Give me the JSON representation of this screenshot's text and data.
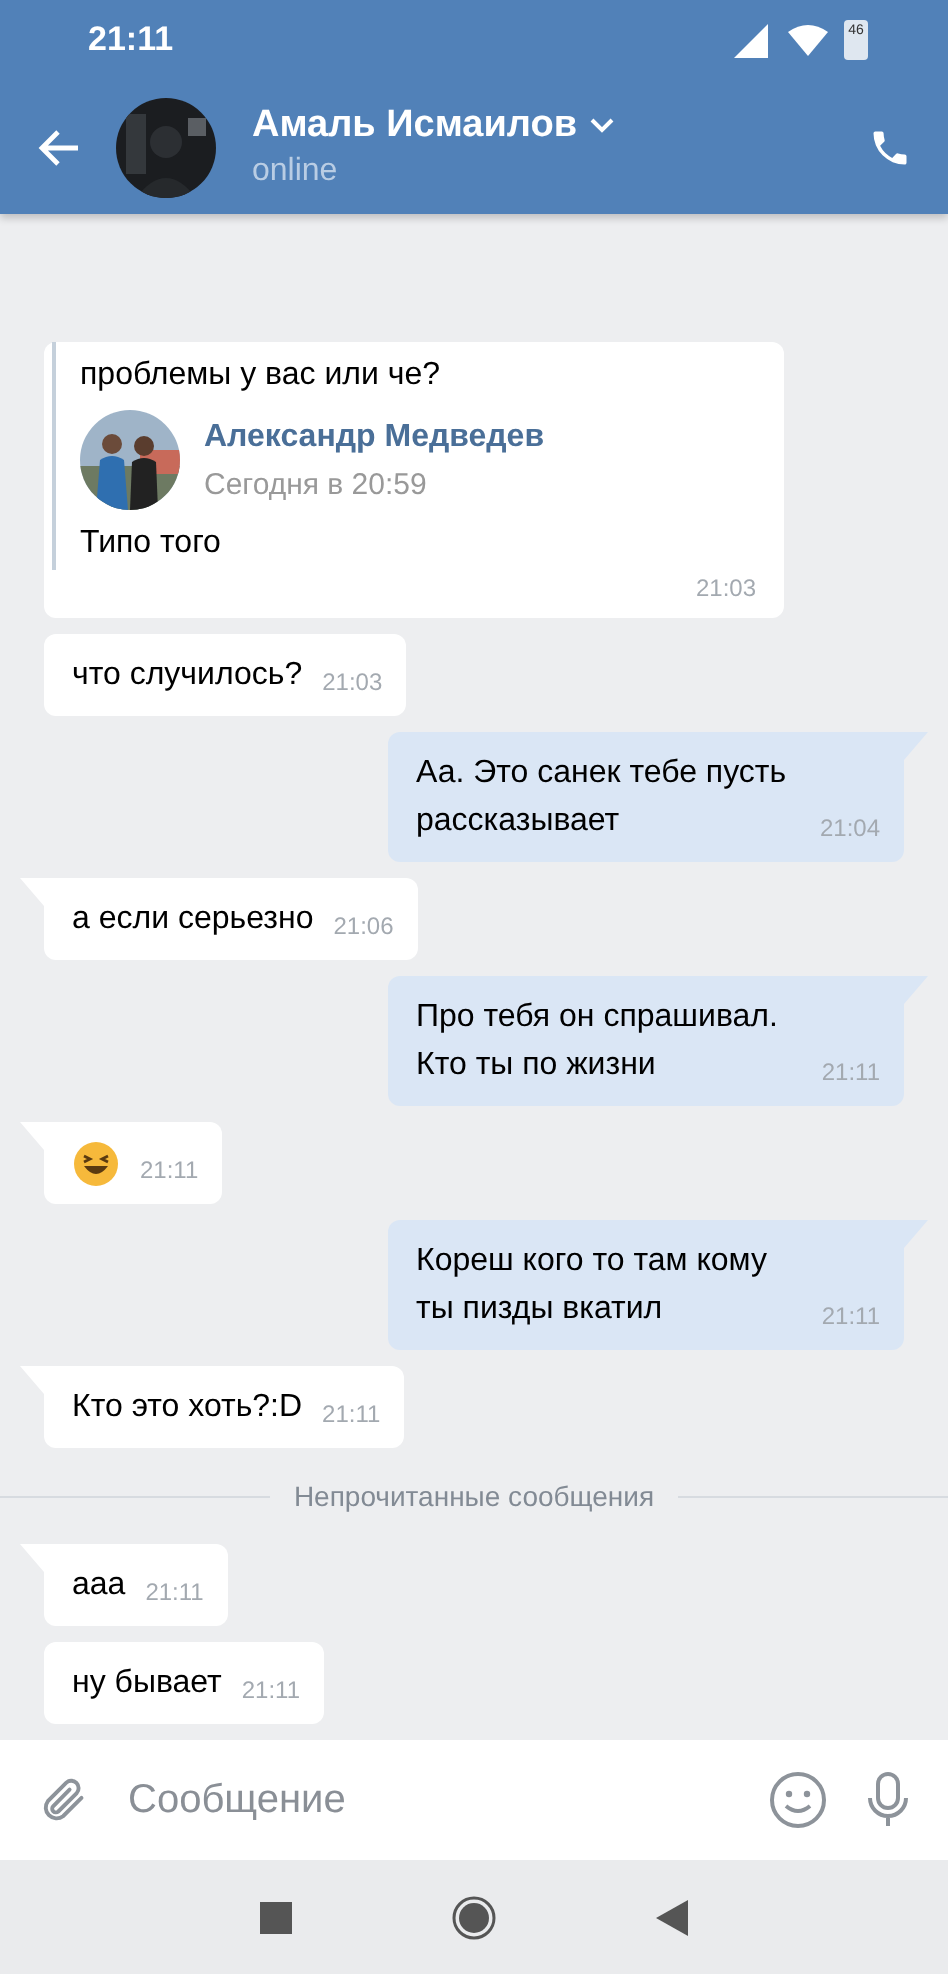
{
  "status_bar": {
    "time": "21:11",
    "battery": "46"
  },
  "header": {
    "name": "Амаль Исмаилов",
    "status": "online"
  },
  "forward": {
    "text": "проблемы у вас или че?",
    "author": "Александр Медведев",
    "date": "Сегодня в 20:59",
    "reply": "Типо того",
    "time": "21:03"
  },
  "messages": [
    {
      "kind": "in",
      "tail": false,
      "text": "что случилось?",
      "time": "21:03"
    },
    {
      "kind": "out",
      "tail": true,
      "text": "Аа. Это санек тебе пусть рассказывает",
      "time": "21:04"
    },
    {
      "kind": "in",
      "tail": true,
      "text": "а если серьезно",
      "time": "21:06"
    },
    {
      "kind": "out",
      "tail": true,
      "text": "Про тебя он спрашивал. Кто ты по жизни",
      "time": "21:11"
    },
    {
      "kind": "emoji",
      "tail": true,
      "time": "21:11"
    },
    {
      "kind": "out",
      "tail": true,
      "text": "Кореш кого то там кому ты пизды вкатил",
      "time": "21:11"
    },
    {
      "kind": "in",
      "tail": true,
      "text": "Кто это хоть?:D",
      "time": "21:11"
    },
    {
      "kind": "divider",
      "text": "Непрочитанные сообщения"
    },
    {
      "kind": "in",
      "tail": true,
      "text": "ааа",
      "time": "21:11"
    },
    {
      "kind": "in",
      "tail": false,
      "text": "ну бывает",
      "time": "21:11"
    }
  ],
  "composer": {
    "placeholder": "Сообщение"
  }
}
